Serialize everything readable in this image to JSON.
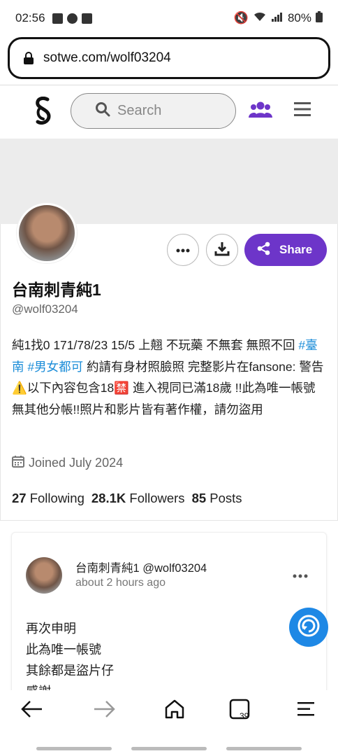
{
  "status_bar": {
    "time": "02:56",
    "battery": "80%"
  },
  "browser": {
    "url": "sotwe.com/wolf03204",
    "tabs_count": "39"
  },
  "nav": {
    "search_placeholder": "Search"
  },
  "profile": {
    "name": "台南刺青純1",
    "handle": "@wolf03204",
    "bio_line1": "純1找0 171/78/23 15/5 上翹 不玩藥 不無套 無照不回 ",
    "hashtag1": "#臺南",
    "hashtag2": "#男女都可",
    "bio_line2": " 約請有身材照臉照 完整影片在fansone: 警告⚠️以下內容包含18🈲 進入視同已滿18歲 !!此為唯一帳號 無其他分帳!!照片和影片皆有著作權，請勿盜用",
    "joined": "Joined July 2024",
    "following_count": "27",
    "following_label": "Following",
    "followers_count": "28.1K",
    "followers_label": "Followers",
    "posts_count": "85",
    "posts_label": "Posts",
    "share_label": "Share"
  },
  "post": {
    "author": "台南刺青純1 @wolf03204",
    "time": "about 2 hours ago",
    "line1": "再次申明",
    "line2": "此為唯一帳號",
    "line3": "其餘都是盜片仔",
    "line4": "感謝"
  },
  "colors": {
    "accent": "#6d35c9",
    "link": "#1a8cd8",
    "fab": "#1e88e5"
  }
}
